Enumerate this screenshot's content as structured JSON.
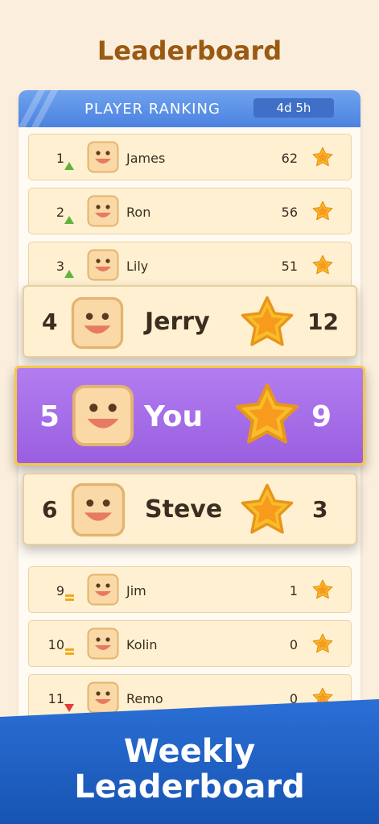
{
  "title": "Leaderboard",
  "header": {
    "label": "PLAYER RANKING",
    "timer": "4d 5h"
  },
  "rows": [
    {
      "rank": "1",
      "trend": "up",
      "name": "James",
      "score": "62"
    },
    {
      "rank": "2",
      "trend": "up",
      "name": "Ron",
      "score": "56"
    },
    {
      "rank": "3",
      "trend": "up",
      "name": "Lily",
      "score": "51"
    },
    {
      "rank": "9",
      "trend": "same",
      "name": "Jim",
      "score": "1"
    },
    {
      "rank": "10",
      "trend": "same",
      "name": "Kolin",
      "score": "0"
    },
    {
      "rank": "11",
      "trend": "down",
      "name": "Remo",
      "score": "0"
    }
  ],
  "featured": [
    {
      "rank": "4",
      "name": "Jerry",
      "score": "12",
      "style": "cream"
    },
    {
      "rank": "5",
      "name": "You",
      "score": "9",
      "style": "purple"
    },
    {
      "rank": "6",
      "name": "Steve",
      "score": "3",
      "style": "cream"
    }
  ],
  "banner": {
    "line1": "Weekly",
    "line2": "Leaderboard"
  },
  "colors": {
    "accent_blue": "#4b82e0",
    "title_brown": "#9a5a12",
    "highlight_purple": "#a56be6",
    "star_gold": "#f7b925"
  },
  "icons": {
    "avatar": "smiley-face-icon",
    "score": "star-icon",
    "up": "triangle-up-icon",
    "down": "triangle-down-icon",
    "same": "equal-icon"
  }
}
